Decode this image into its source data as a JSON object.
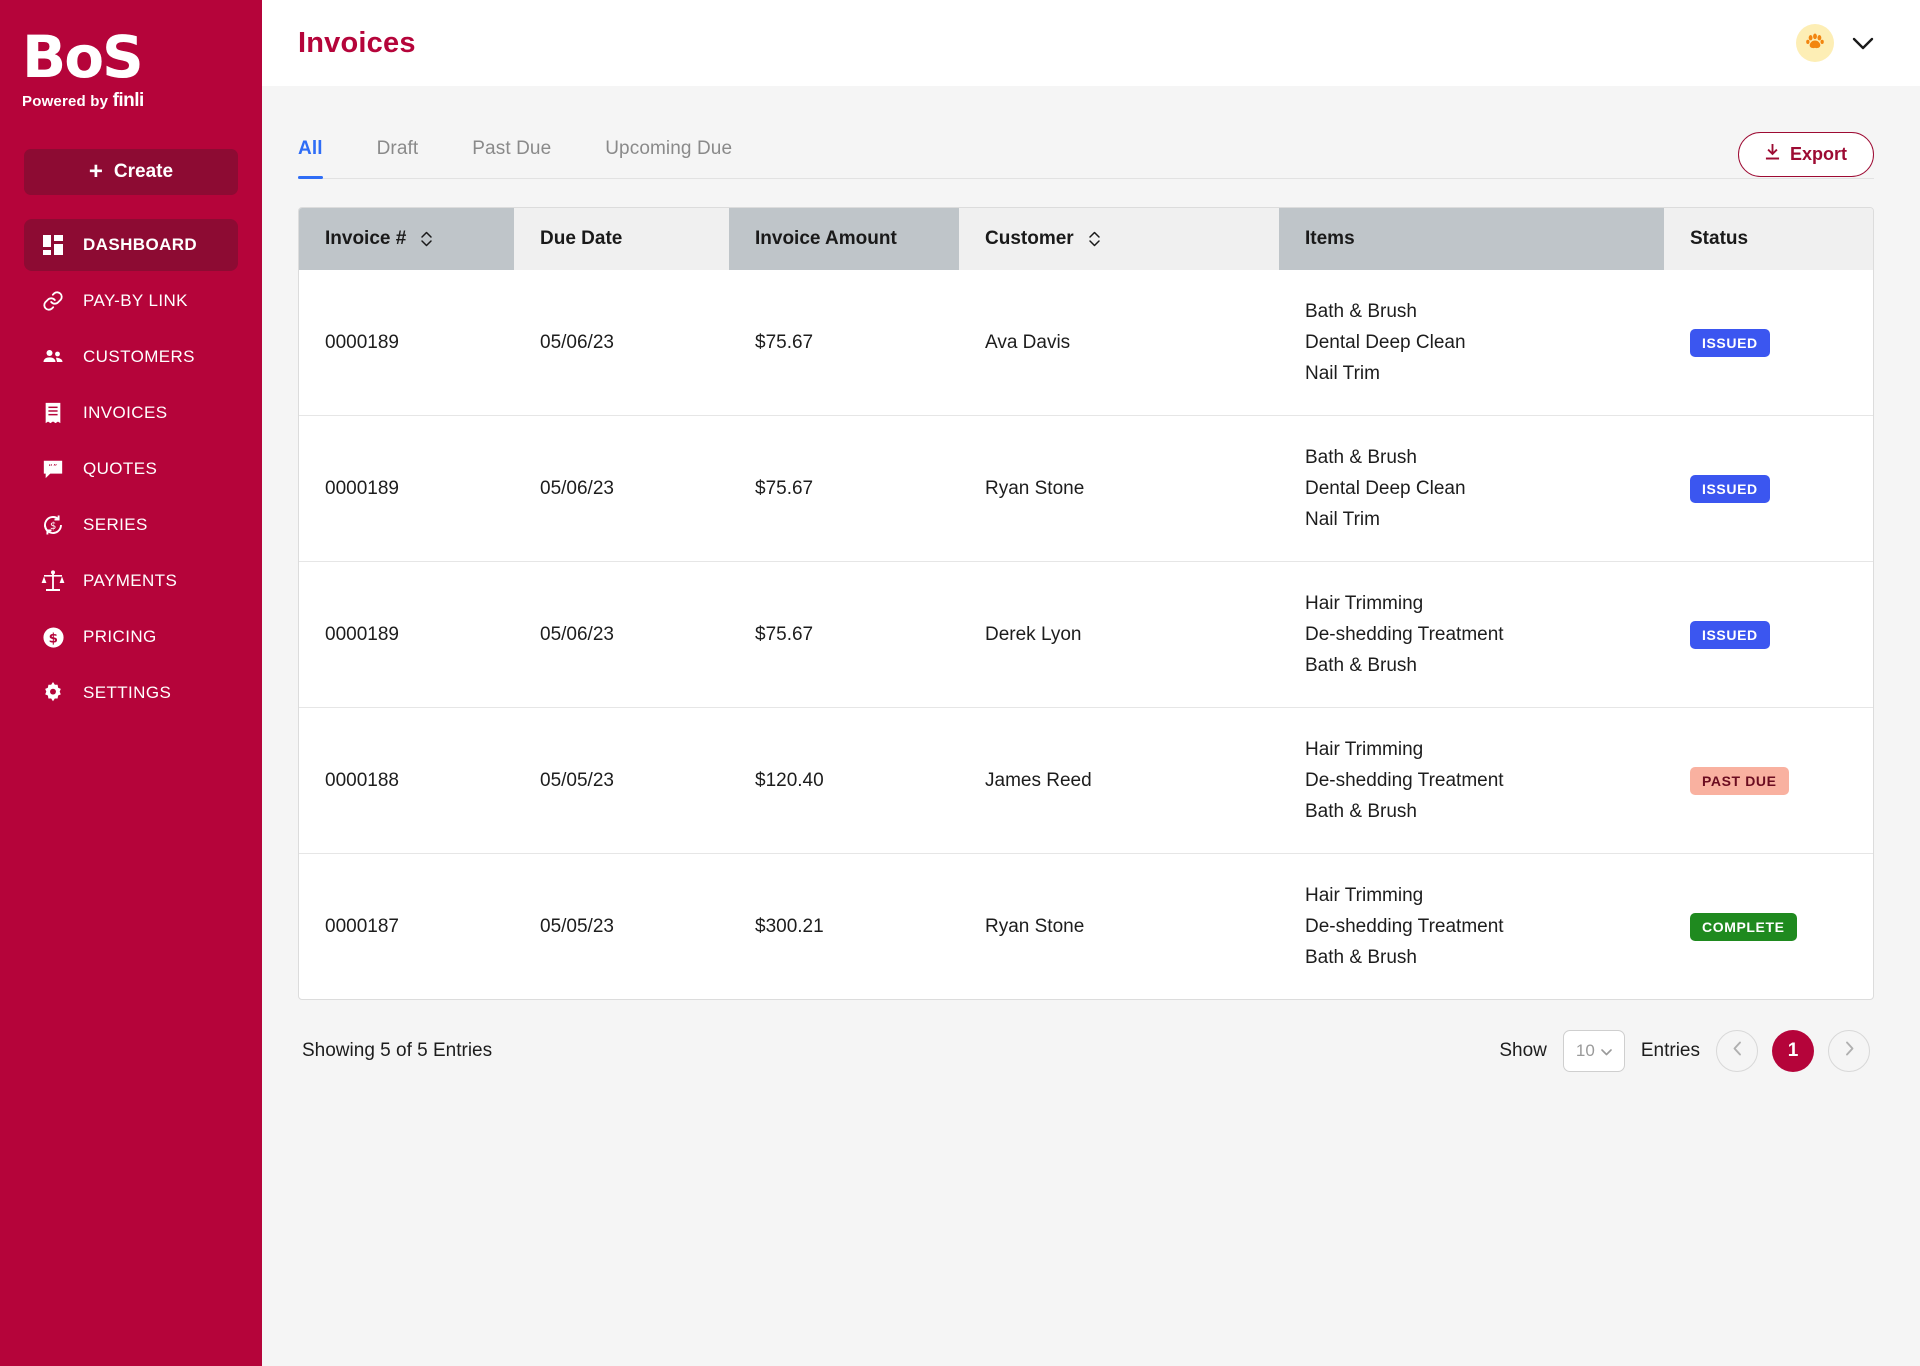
{
  "sidebar": {
    "logo": {
      "mark": "BoS",
      "powered_prefix": "Powered by ",
      "powered_brand": "finli"
    },
    "create_button": {
      "label": "Create",
      "icon": "plus-icon"
    },
    "items": [
      {
        "label": "DASHBOARD",
        "icon": "dashboard-icon",
        "active": true
      },
      {
        "label": "PAY-BY LINK",
        "icon": "link-icon",
        "active": false
      },
      {
        "label": "CUSTOMERS",
        "icon": "people-icon",
        "active": false
      },
      {
        "label": "INVOICES",
        "icon": "invoice-icon",
        "active": false
      },
      {
        "label": "QUOTES",
        "icon": "quote-icon",
        "active": false
      },
      {
        "label": "SERIES",
        "icon": "recurring-dollar-icon",
        "active": false
      },
      {
        "label": "PAYMENTS",
        "icon": "scales-icon",
        "active": false
      },
      {
        "label": "PRICING",
        "icon": "dollar-circle-icon",
        "active": false
      },
      {
        "label": "SETTINGS",
        "icon": "gear-icon",
        "active": false
      }
    ]
  },
  "header": {
    "title": "Invoices",
    "avatar_icon": "paw-icon",
    "chevron_icon": "chevron-down-icon"
  },
  "toolbar": {
    "tabs": [
      {
        "label": "All",
        "active": true
      },
      {
        "label": "Draft",
        "active": false
      },
      {
        "label": "Past Due",
        "active": false
      },
      {
        "label": "Upcoming Due",
        "active": false
      }
    ],
    "export_label": "Export",
    "export_icon": "download-icon"
  },
  "table": {
    "columns": [
      {
        "label": "Invoice #",
        "shaded": true,
        "sortable": true
      },
      {
        "label": "Due Date",
        "shaded": false,
        "sortable": false
      },
      {
        "label": "Invoice Amount",
        "shaded": true,
        "sortable": false
      },
      {
        "label": "Customer",
        "shaded": false,
        "sortable": true
      },
      {
        "label": "Items",
        "shaded": true,
        "sortable": false
      },
      {
        "label": "Status",
        "shaded": false,
        "sortable": false
      }
    ],
    "rows": [
      {
        "invoice": "0000189",
        "due_date": "05/06/23",
        "amount": "$75.67",
        "customer": "Ava Davis",
        "items": "Bath & Brush\nDental Deep Clean\nNail Trim",
        "status": "ISSUED",
        "status_kind": "issued"
      },
      {
        "invoice": "0000189",
        "due_date": "05/06/23",
        "amount": "$75.67",
        "customer": "Ryan Stone",
        "items": "Bath & Brush\nDental Deep Clean\nNail Trim",
        "status": "ISSUED",
        "status_kind": "issued"
      },
      {
        "invoice": "0000189",
        "due_date": "05/06/23",
        "amount": "$75.67",
        "customer": "Derek Lyon",
        "items": "Hair Trimming\nDe-shedding Treatment\nBath & Brush",
        "status": "ISSUED",
        "status_kind": "issued"
      },
      {
        "invoice": "0000188",
        "due_date": "05/05/23",
        "amount": "$120.40",
        "customer": "James Reed",
        "items": "Hair Trimming\nDe-shedding Treatment\nBath & Brush",
        "status": "PAST DUE",
        "status_kind": "pastdue"
      },
      {
        "invoice": "0000187",
        "due_date": "05/05/23",
        "amount": "$300.21",
        "customer": "Ryan Stone",
        "items": "Hair Trimming\nDe-shedding Treatment\nBath & Brush",
        "status": "COMPLETE",
        "status_kind": "complete"
      }
    ]
  },
  "footer": {
    "showing_text": "Showing 5 of 5 Entries",
    "show_label": "Show",
    "entries_label": "Entries",
    "page_size": "10",
    "current_page": "1",
    "prev_icon": "chevron-left-icon",
    "next_icon": "chevron-right-icon"
  },
  "colors": {
    "brand": "#b5043a",
    "brand_dark": "#8d0b33",
    "tab_active": "#2f6df6",
    "issued": "#3b56f0",
    "past_due_bg": "#f9b1a0",
    "complete": "#1f8a1f",
    "header_shaded": "#bfc5c9"
  }
}
